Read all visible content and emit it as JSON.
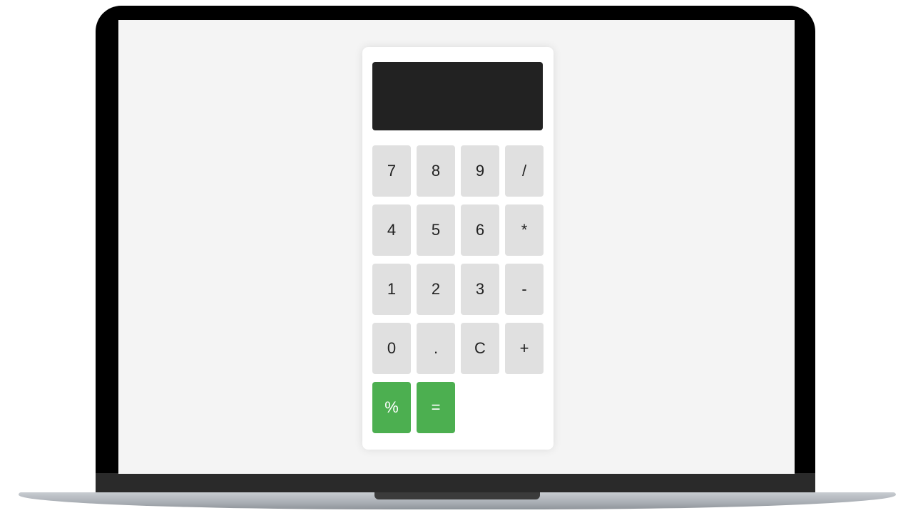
{
  "calculator": {
    "display_value": "",
    "keys": [
      {
        "label": "7",
        "name": "key-7"
      },
      {
        "label": "8",
        "name": "key-8"
      },
      {
        "label": "9",
        "name": "key-9"
      },
      {
        "label": "/",
        "name": "key-divide"
      },
      {
        "label": "4",
        "name": "key-4"
      },
      {
        "label": "5",
        "name": "key-5"
      },
      {
        "label": "6",
        "name": "key-6"
      },
      {
        "label": "*",
        "name": "key-multiply"
      },
      {
        "label": "1",
        "name": "key-1"
      },
      {
        "label": "2",
        "name": "key-2"
      },
      {
        "label": "3",
        "name": "key-3"
      },
      {
        "label": "-",
        "name": "key-subtract"
      },
      {
        "label": "0",
        "name": "key-0"
      },
      {
        "label": ".",
        "name": "key-decimal"
      },
      {
        "label": "C",
        "name": "key-clear"
      },
      {
        "label": "+",
        "name": "key-add"
      },
      {
        "label": "%",
        "name": "key-percent"
      },
      {
        "label": "=",
        "name": "key-equals"
      }
    ]
  },
  "colors": {
    "display_bg": "#222222",
    "key_bg": "#e0e0e0",
    "accent_key_bg": "#4caf50",
    "screen_bg": "#f4f4f4"
  }
}
